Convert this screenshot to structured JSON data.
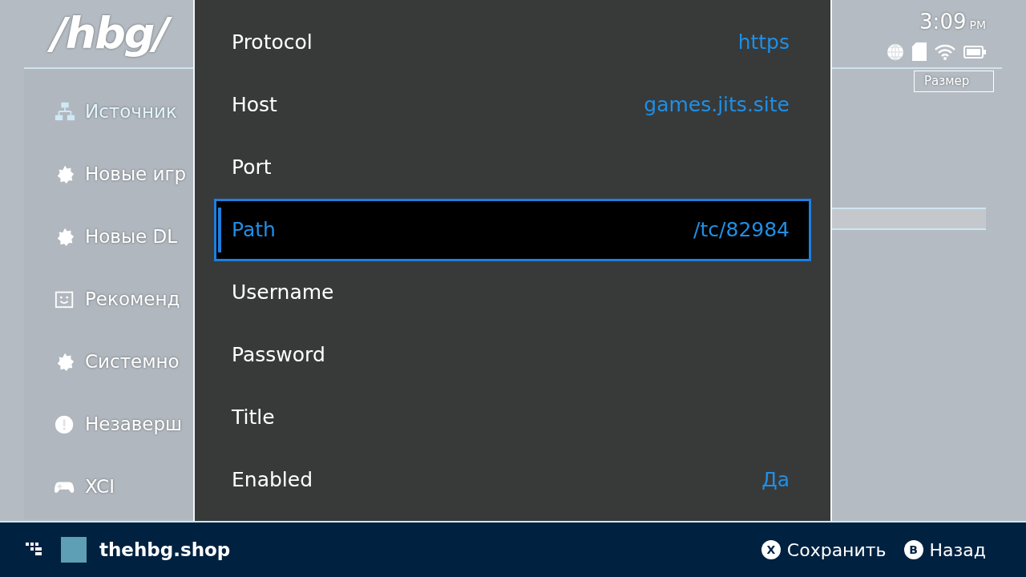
{
  "header": {
    "logo": "/hbg/",
    "clock": "3:09",
    "clock_suffix": "PM"
  },
  "sidebar": {
    "items": [
      {
        "label": "Источник",
        "kind": "sources",
        "selected": true
      },
      {
        "label": "Новые игр",
        "kind": "badge",
        "selected": false
      },
      {
        "label": "Новые DL",
        "kind": "badge",
        "selected": false
      },
      {
        "label": "Рекоменд",
        "kind": "smile",
        "selected": false
      },
      {
        "label": "Системно",
        "kind": "badge",
        "selected": false
      },
      {
        "label": "Незаверш",
        "kind": "alert",
        "selected": false
      },
      {
        "label": "XCI",
        "kind": "gamepad",
        "selected": false
      }
    ]
  },
  "table": {
    "columns": [
      "Размер"
    ]
  },
  "dialog": {
    "fields": [
      {
        "label": "Protocol",
        "value": "https",
        "selected": false
      },
      {
        "label": "Host",
        "value": "games.jits.site",
        "selected": false
      },
      {
        "label": "Port",
        "selected": false
      },
      {
        "label": "Path",
        "value": "/tc/82984",
        "selected": true
      },
      {
        "label": "Username",
        "selected": false
      },
      {
        "label": "Password",
        "selected": false
      },
      {
        "label": "Title",
        "selected": false
      },
      {
        "label": "Enabled",
        "value": "Да",
        "selected": false
      }
    ]
  },
  "footer": {
    "shop": "thehbg.shop",
    "actions": [
      {
        "key": "X",
        "label": "Сохранить"
      },
      {
        "key": "B",
        "label": "Назад"
      }
    ]
  }
}
